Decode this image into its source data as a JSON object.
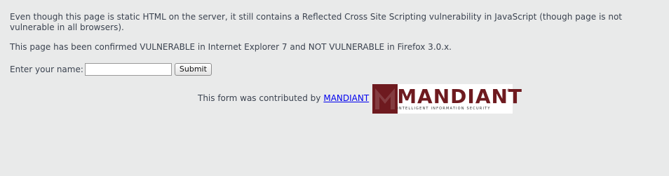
{
  "paragraphs": {
    "intro": "Even though this page is static HTML on the server, it still contains a Reflected Cross Site Scripting vulnerability in JavaScript (though page is not vulnerable in all browsers).",
    "status": "This page has been confirmed VULNERABLE in Internet Explorer 7 and NOT VULNERABLE in Firefox 3.0.x."
  },
  "form": {
    "label": "Enter your name:",
    "input_value": "",
    "submit_label": "Submit"
  },
  "contribution": {
    "text": "This form was contributed by",
    "link_text": "MANDIANT"
  },
  "logo": {
    "wordmark": "MANDIANT",
    "tagline": "INTELLIGENT INFORMATION SECURITY",
    "registered": "®",
    "brand_color": "#6e1a1f"
  },
  "colors": {
    "background": "#e9eaea",
    "text": "#3b4350",
    "link": "#0000ee"
  }
}
